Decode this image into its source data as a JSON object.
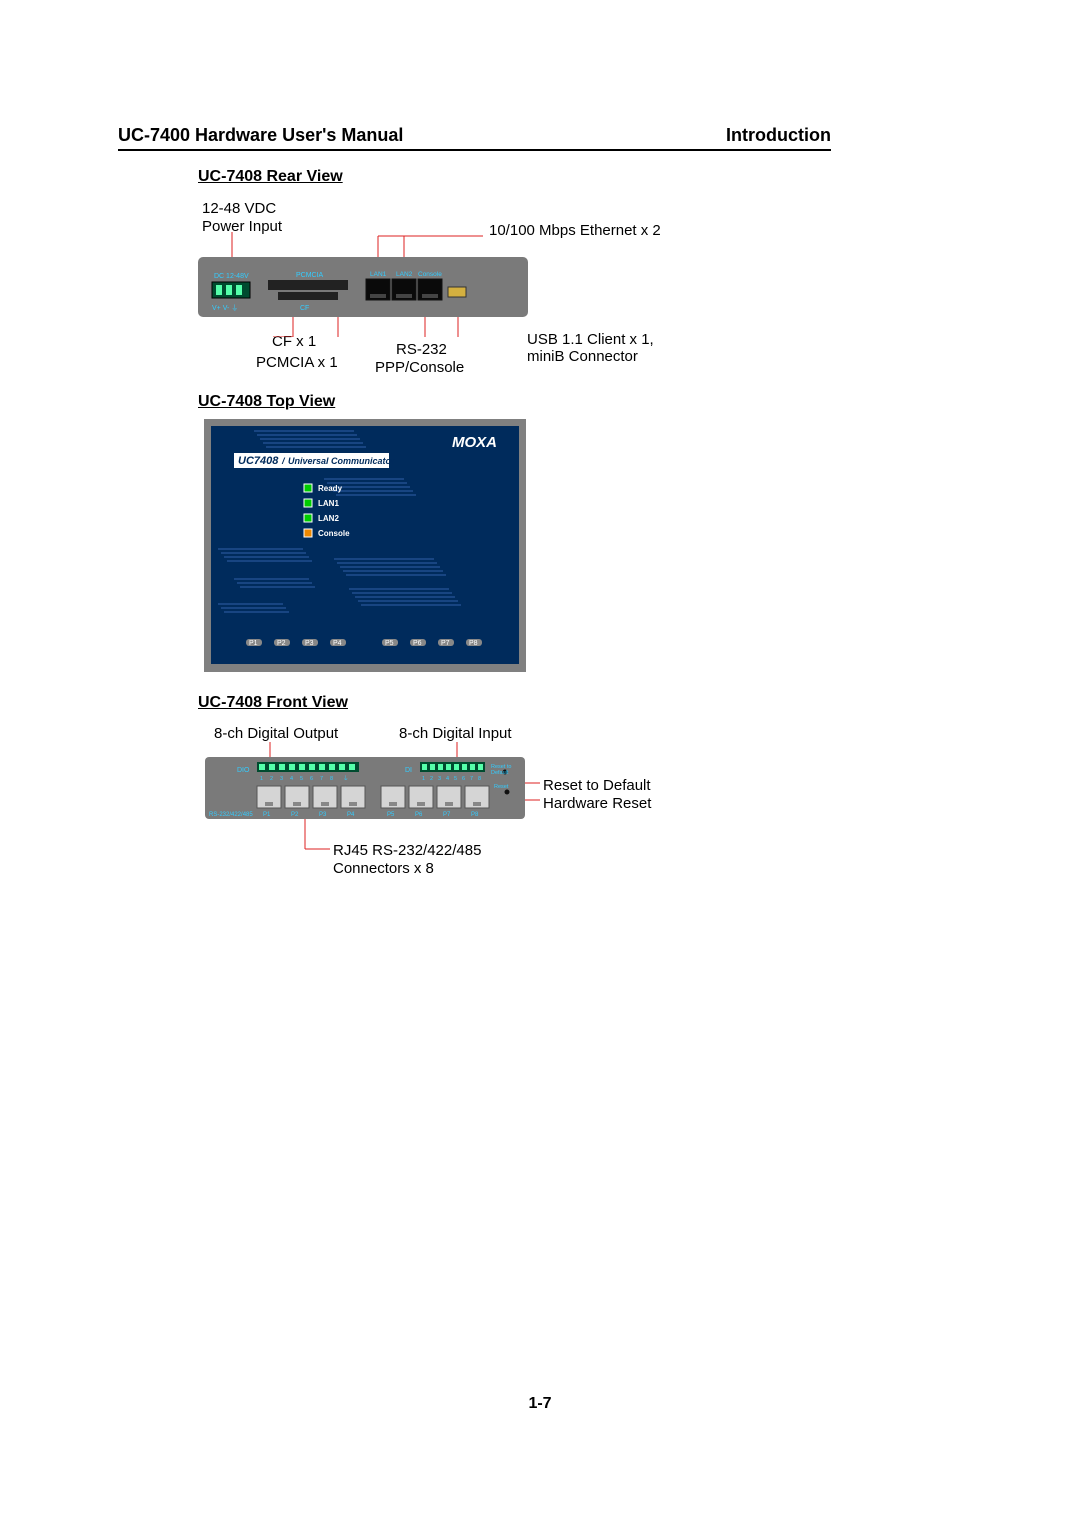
{
  "header": {
    "left": "UC-7400 Hardware User's Manual",
    "right": "Introduction"
  },
  "sections": {
    "rear": "UC-7408 Rear View",
    "top": "UC-7408 Top View",
    "front": "UC-7408 Front View"
  },
  "rear": {
    "power1": "12-48 VDC",
    "power2": "Power Input",
    "eth": "10/100 Mbps Ethernet x 2",
    "cf": "CF x 1",
    "pcmcia": "PCMCIA x 1",
    "rs": "RS-232",
    "ppp": "PPP/Console",
    "usb1": "USB 1.1 Client x 1,",
    "usb2": "miniB Connector",
    "panel": {
      "dc": "DC 12-48V",
      "pc": "PCMCIA",
      "cf": "CF",
      "lan1": "LAN1",
      "lan2": "LAN2",
      "cons": "Console",
      "vplus": "V+",
      "vminus": "V-"
    }
  },
  "topview": {
    "brand": "MOXA",
    "model": "UC7408",
    "slash": "/",
    "subtitle": "Universal Communicator",
    "leds": {
      "ready": "Ready",
      "lan1": "LAN1",
      "lan2": "LAN2",
      "console": "Console"
    },
    "ports": [
      "P1",
      "P2",
      "P3",
      "P4",
      "P5",
      "P6",
      "P7",
      "P8"
    ]
  },
  "front": {
    "do": "8-ch Digital Output",
    "di": "8-ch Digital Input",
    "reset": "Reset to Default",
    "hwreset": "Hardware Reset",
    "rj1": "RJ45 RS-232/422/485",
    "rj2": "Connectors x 8",
    "panel": {
      "dio": "DIO",
      "di": "DI",
      "rst1": "Reset to",
      "rst2": "Default",
      "rst3": "Reset",
      "bus": "RS-232/422/485",
      "ports": [
        "P1",
        "P2",
        "P3",
        "P4",
        "P5",
        "P6",
        "P7",
        "P8"
      ],
      "nums": [
        "1",
        "2",
        "3",
        "4",
        "5",
        "6",
        "7",
        "8"
      ],
      "gnd": "⏚"
    }
  },
  "pagenum": "1-7"
}
